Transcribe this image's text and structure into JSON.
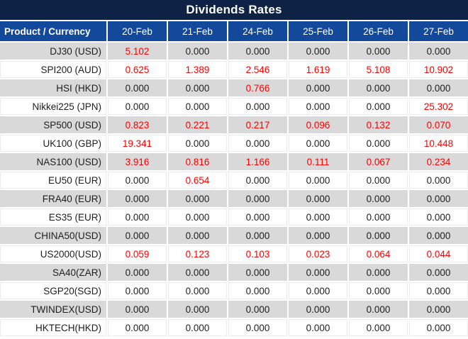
{
  "title": "Dividends Rates",
  "table": {
    "product_header": "Product / Currency",
    "date_headers": [
      "20-Feb",
      "21-Feb",
      "24-Feb",
      "25-Feb",
      "26-Feb",
      "27-Feb"
    ],
    "rows": [
      {
        "product": "DJ30 (USD)",
        "values": [
          "5.102",
          "0.000",
          "0.000",
          "0.000",
          "0.000",
          "0.000"
        ]
      },
      {
        "product": "SPI200 (AUD)",
        "values": [
          "0.625",
          "1.389",
          "2.546",
          "1.619",
          "5.108",
          "10.902"
        ]
      },
      {
        "product": "HSI (HKD)",
        "values": [
          "0.000",
          "0.000",
          "0.766",
          "0.000",
          "0.000",
          "0.000"
        ]
      },
      {
        "product": "Nikkei225 (JPN)",
        "values": [
          "0.000",
          "0.000",
          "0.000",
          "0.000",
          "0.000",
          "25.302"
        ]
      },
      {
        "product": "SP500 (USD)",
        "values": [
          "0.823",
          "0.221",
          "0.217",
          "0.096",
          "0.132",
          "0.070"
        ]
      },
      {
        "product": "UK100 (GBP)",
        "values": [
          "19.341",
          "0.000",
          "0.000",
          "0.000",
          "0.000",
          "10.448"
        ]
      },
      {
        "product": "NAS100 (USD)",
        "values": [
          "3.916",
          "0.816",
          "1.166",
          "0.111",
          "0.067",
          "0.234"
        ]
      },
      {
        "product": "EU50 (EUR)",
        "values": [
          "0.000",
          "0.654",
          "0.000",
          "0.000",
          "0.000",
          "0.000"
        ]
      },
      {
        "product": "FRA40 (EUR)",
        "values": [
          "0.000",
          "0.000",
          "0.000",
          "0.000",
          "0.000",
          "0.000"
        ]
      },
      {
        "product": "ES35 (EUR)",
        "values": [
          "0.000",
          "0.000",
          "0.000",
          "0.000",
          "0.000",
          "0.000"
        ]
      },
      {
        "product": "CHINA50(USD)",
        "values": [
          "0.000",
          "0.000",
          "0.000",
          "0.000",
          "0.000",
          "0.000"
        ]
      },
      {
        "product": "US2000(USD)",
        "values": [
          "0.059",
          "0.123",
          "0.103",
          "0.023",
          "0.064",
          "0.044"
        ]
      },
      {
        "product": "SA40(ZAR)",
        "values": [
          "0.000",
          "0.000",
          "0.000",
          "0.000",
          "0.000",
          "0.000"
        ]
      },
      {
        "product": "SGP20(SGD)",
        "values": [
          "0.000",
          "0.000",
          "0.000",
          "0.000",
          "0.000",
          "0.000"
        ]
      },
      {
        "product": "TWINDEX(USD)",
        "values": [
          "0.000",
          "0.000",
          "0.000",
          "0.000",
          "0.000",
          "0.000"
        ]
      },
      {
        "product": "HKTECH(HKD)",
        "values": [
          "0.000",
          "0.000",
          "0.000",
          "0.000",
          "0.000",
          "0.000"
        ]
      }
    ]
  },
  "colors": {
    "title_bg": "#0e2245",
    "header_bg": "#13499b",
    "band_bg": "#d9d9d9",
    "nonzero_value": "#fb0000",
    "zero_value": "#1e1e1e",
    "header_text": "#ffffff"
  }
}
